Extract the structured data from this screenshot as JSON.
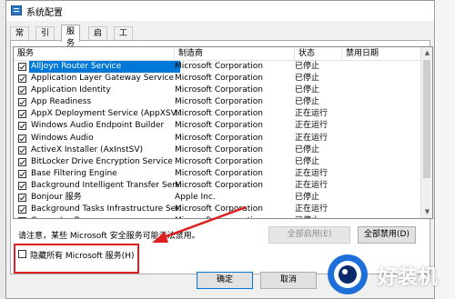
{
  "window": {
    "title": "系统配置"
  },
  "tabs": [
    {
      "label": "常规"
    },
    {
      "label": "引导"
    },
    {
      "label": "服务"
    },
    {
      "label": "启动"
    },
    {
      "label": "工具"
    }
  ],
  "services_list": {
    "headers": {
      "service": "服务",
      "manufacturer": "制造商",
      "status": "状态",
      "disabled_date": "禁用日期"
    },
    "rows": [
      {
        "name": "AllJoyn Router Service",
        "manufacturer": "Microsoft Corporation",
        "status": "已停止"
      },
      {
        "name": "Application Layer Gateway Service",
        "manufacturer": "Microsoft Corporation",
        "status": "已停止"
      },
      {
        "name": "Application Identity",
        "manufacturer": "Microsoft Corporation",
        "status": "已停止"
      },
      {
        "name": "App Readiness",
        "manufacturer": "Microsoft Corporation",
        "status": "已停止"
      },
      {
        "name": "AppX Deployment Service (AppXSV...",
        "manufacturer": "Microsoft Corporation",
        "status": "正在运行"
      },
      {
        "name": "Windows Audio Endpoint Builder",
        "manufacturer": "Microsoft Corporation",
        "status": "正在运行"
      },
      {
        "name": "Windows Audio",
        "manufacturer": "Microsoft Corporation",
        "status": "正在运行"
      },
      {
        "name": "ActiveX Installer (AxInstSV)",
        "manufacturer": "Microsoft Corporation",
        "status": "已停止"
      },
      {
        "name": "BitLocker Drive Encryption Service",
        "manufacturer": "Microsoft Corporation",
        "status": "已停止"
      },
      {
        "name": "Base Filtering Engine",
        "manufacturer": "Microsoft Corporation",
        "status": "正在运行"
      },
      {
        "name": "Background Intelligent Transfer Serv...",
        "manufacturer": "Microsoft Corporation",
        "status": "正在运行"
      },
      {
        "name": "Bonjour 服务",
        "manufacturer": "Apple Inc.",
        "status": "已停止"
      },
      {
        "name": "Background Tasks Infrastructure Ser...",
        "manufacturer": "Microsoft Corporation",
        "status": "正在运行"
      },
      {
        "name": "Computer Browser",
        "manufacturer": "Microsoft Corporation",
        "status": "已停止"
      }
    ]
  },
  "note": "请注意，某些 Microsoft 安全服务可能无法禁用。",
  "buttons": {
    "enable_all": "全部启用(E)",
    "disable_all": "全部禁用(D)",
    "ok": "确定",
    "cancel": "取消"
  },
  "hide_microsoft": {
    "label": "隐藏所有 Microsoft 服务(H)"
  },
  "watermark": {
    "text": "好装机"
  },
  "colors": {
    "highlight": "#e02020",
    "selection": "#0078d7"
  }
}
